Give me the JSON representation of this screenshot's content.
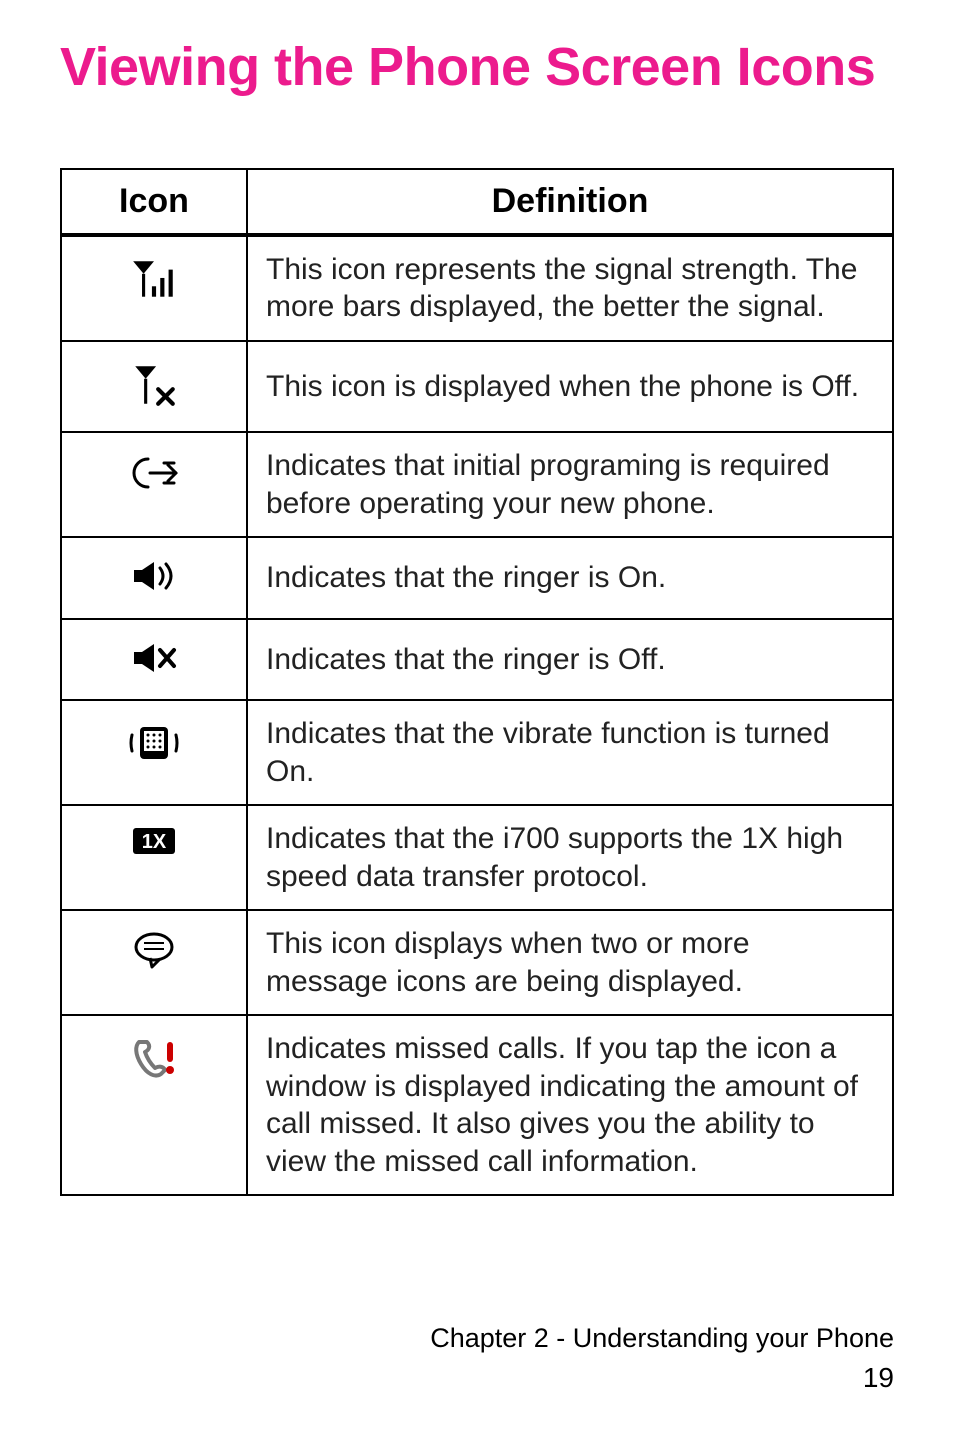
{
  "title": "Viewing the Phone Screen Icons",
  "columns": {
    "icon": "Icon",
    "definition": "Definition"
  },
  "rows": [
    {
      "icon": "signal",
      "definition": "This icon represents the signal strength. The more bars displayed, the better the signal."
    },
    {
      "icon": "phone-off",
      "definition": "This icon is displayed when the phone is Off."
    },
    {
      "icon": "programming-required",
      "definition": "Indicates that initial programing is required before operating your new phone."
    },
    {
      "icon": "ringer-on",
      "definition": "Indicates that the ringer is On."
    },
    {
      "icon": "ringer-off",
      "definition": "Indicates that the ringer is Off."
    },
    {
      "icon": "vibrate-on",
      "definition": "Indicates that the vibrate function is turned On."
    },
    {
      "icon": "one-x",
      "definition": "Indicates that the i700 supports the 1X high speed data transfer protocol."
    },
    {
      "icon": "messages",
      "definition": "This icon displays when two or more message icons are being displayed."
    },
    {
      "icon": "missed-calls",
      "definition": "Indicates missed calls. If you tap the icon a window is displayed indicating the amount of call missed. It also gives you the ability to view the missed call information."
    }
  ],
  "footer": {
    "chapter": "Chapter 2 - Understanding your Phone",
    "page": "19"
  },
  "icon_labels": {
    "signal": "signal",
    "phone-off": "phone-off",
    "programming-required": "programming-required",
    "ringer-on": "ringer-on",
    "ringer-off": "ringer-off",
    "vibrate-on": "vibrate-on",
    "one-x": "one-x",
    "messages": "messages",
    "missed-calls": "missed-calls"
  }
}
